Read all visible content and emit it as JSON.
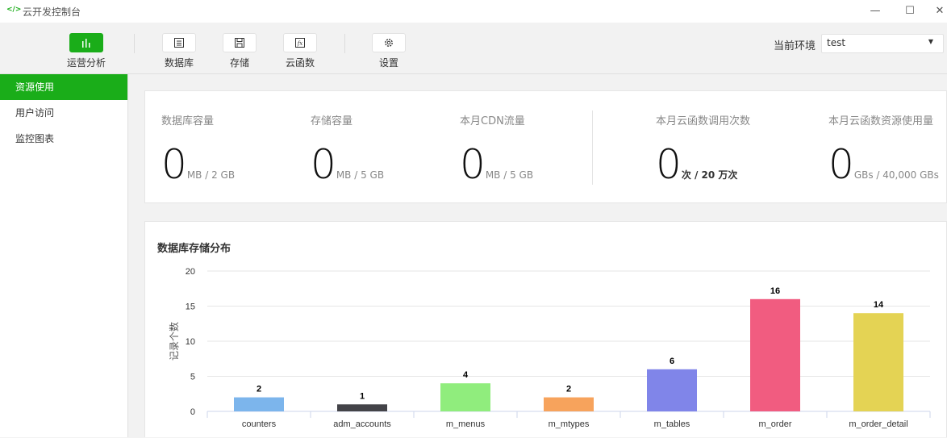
{
  "window": {
    "title": "云开发控制台",
    "icon": "</>"
  },
  "toolbar": {
    "tabs": [
      {
        "label": "运营分析",
        "icon": "bar-chart-icon",
        "active": true
      },
      {
        "label": "数据库",
        "icon": "database-icon",
        "active": false
      },
      {
        "label": "存储",
        "icon": "storage-icon",
        "active": false
      },
      {
        "label": "云函数",
        "icon": "function-icon",
        "active": false
      },
      {
        "label": "设置",
        "icon": "gear-icon",
        "active": false
      }
    ],
    "env_label": "当前环境",
    "env_value": "test"
  },
  "sidebar": {
    "items": [
      {
        "label": "资源使用",
        "active": true
      },
      {
        "label": "用户访问",
        "active": false
      },
      {
        "label": "监控图表",
        "active": false
      }
    ]
  },
  "stats": [
    {
      "label": "数据库容量",
      "value": "0",
      "unit": "MB / 2 GB"
    },
    {
      "label": "存储容量",
      "value": "0",
      "unit": "MB / 5 GB"
    },
    {
      "label": "本月CDN流量",
      "value": "0",
      "unit": "MB / 5 GB"
    },
    {
      "label": "本月云函数调用次数",
      "value": "0",
      "unit": "次 / 20 万次"
    },
    {
      "label": "本月云函数资源使用量",
      "value": "0",
      "unit": "GBs / 40,000 GBs"
    }
  ],
  "colors": {
    "accent": "#1aad19"
  },
  "chart_data": {
    "type": "bar",
    "title": "数据库存储分布",
    "ylabel": "记录个数",
    "xlabel": "",
    "categories": [
      "counters",
      "adm_accounts",
      "m_menus",
      "m_mtypes",
      "m_tables",
      "m_order",
      "m_order_detail"
    ],
    "values": [
      2,
      1,
      4,
      2,
      6,
      16,
      14
    ],
    "colors": [
      "#7cb5ec",
      "#434348",
      "#90ed7d",
      "#f7a35c",
      "#8085e9",
      "#f15c80",
      "#e4d354"
    ],
    "ylim": [
      0,
      20
    ],
    "yticks": [
      0,
      5,
      10,
      15,
      20
    ],
    "grid": true,
    "data_labels": true
  }
}
